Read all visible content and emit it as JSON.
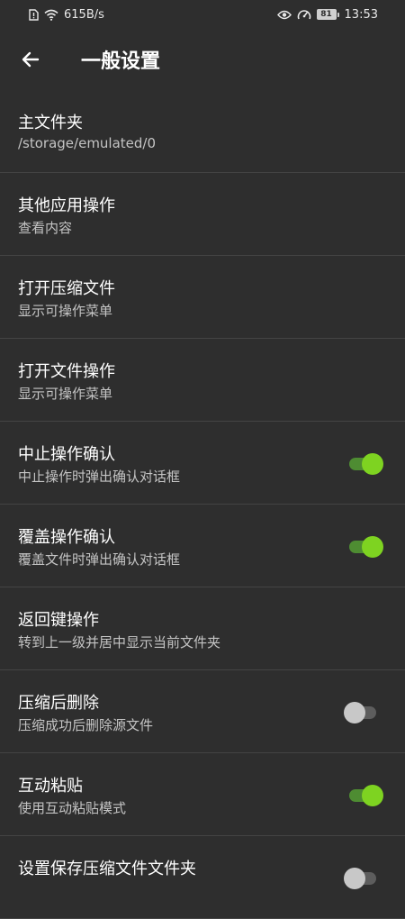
{
  "status_bar": {
    "net_speed": "615B/s",
    "battery": "81",
    "time": "13:53"
  },
  "header": {
    "title": "一般设置"
  },
  "settings": [
    {
      "title": "主文件夹",
      "subtitle": "/storage/emulated/0"
    },
    {
      "title": "其他应用操作",
      "subtitle": "查看内容"
    },
    {
      "title": "打开压缩文件",
      "subtitle": "显示可操作菜单"
    },
    {
      "title": "打开文件操作",
      "subtitle": "显示可操作菜单"
    },
    {
      "title": "中止操作确认",
      "subtitle": "中止操作时弹出确认对话框",
      "toggle": true
    },
    {
      "title": "覆盖操作确认",
      "subtitle": "覆盖文件时弹出确认对话框",
      "toggle": true
    },
    {
      "title": "返回键操作",
      "subtitle": "转到上一级并居中显示当前文件夹"
    },
    {
      "title": "压缩后删除",
      "subtitle": "压缩成功后删除源文件",
      "toggle": false
    },
    {
      "title": "互动粘贴",
      "subtitle": "使用互动粘贴模式",
      "toggle": true
    },
    {
      "title": "设置保存压缩文件文件夹",
      "subtitle": "",
      "toggle": false
    }
  ],
  "colors": {
    "background": "#2e2e2e",
    "toggle_on": "#7ed321",
    "toggle_off": "#c8c8c8"
  }
}
